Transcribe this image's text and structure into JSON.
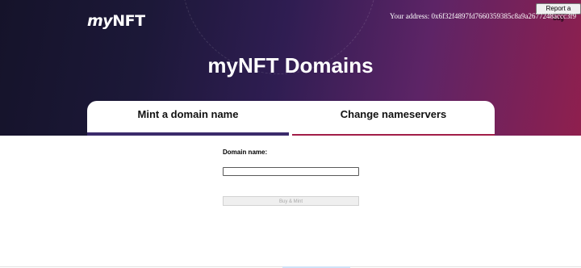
{
  "header": {
    "logo_prefix": "my",
    "logo_suffix": "NFT",
    "report_bug_label": "Report a bug",
    "address_text": "Your address: 0x6f32f4897fd7660359385c8a9a2677248accc3f9",
    "title": "myNFT Domains"
  },
  "tabs": [
    {
      "label": "Mint a domain name",
      "active": true
    },
    {
      "label": "Change nameservers",
      "active": false
    }
  ],
  "form": {
    "domain_label": "Domain name:",
    "domain_value": "",
    "submit_label": "Buy & Mint",
    "submit_disabled": true
  },
  "colors": {
    "tab_active_underline": "#3b2a6b",
    "tab_inactive_underline": "#a21d48",
    "hero_start": "#15132a",
    "hero_end": "#8f1f4e"
  }
}
